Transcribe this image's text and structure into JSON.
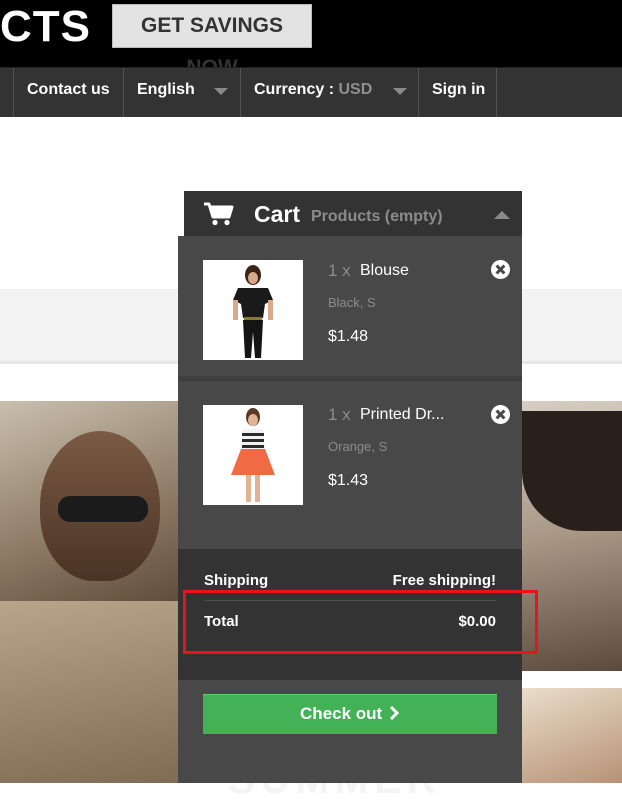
{
  "header": {
    "logo_partial": "CTS",
    "savings_button": "GET SAVINGS NOW"
  },
  "nav": {
    "contact": "Contact us",
    "language": "English",
    "currency_label": "Currency :",
    "currency_value": "USD",
    "signin": "Sign in"
  },
  "cart": {
    "title": "Cart",
    "subtitle": "Products (empty)",
    "items": [
      {
        "qty": "1 x",
        "name": "Blouse",
        "attributes": "Black, S",
        "price": "$1.48"
      },
      {
        "qty": "1 x",
        "name": "Printed Dr...",
        "attributes": "Orange, S",
        "price": "$1.43"
      }
    ],
    "shipping_label": "Shipping",
    "shipping_value": "Free shipping!",
    "total_label": "Total",
    "total_value": "$0.00",
    "checkout_label": "Check out",
    "checkout_icon": "chevron-right-icon"
  },
  "banner": {
    "text": "SUMMER"
  },
  "colors": {
    "nav_bg": "#333333",
    "panel_bg": "#484848",
    "checkout_green": "#43b155",
    "highlight_red": "#e8141a"
  }
}
